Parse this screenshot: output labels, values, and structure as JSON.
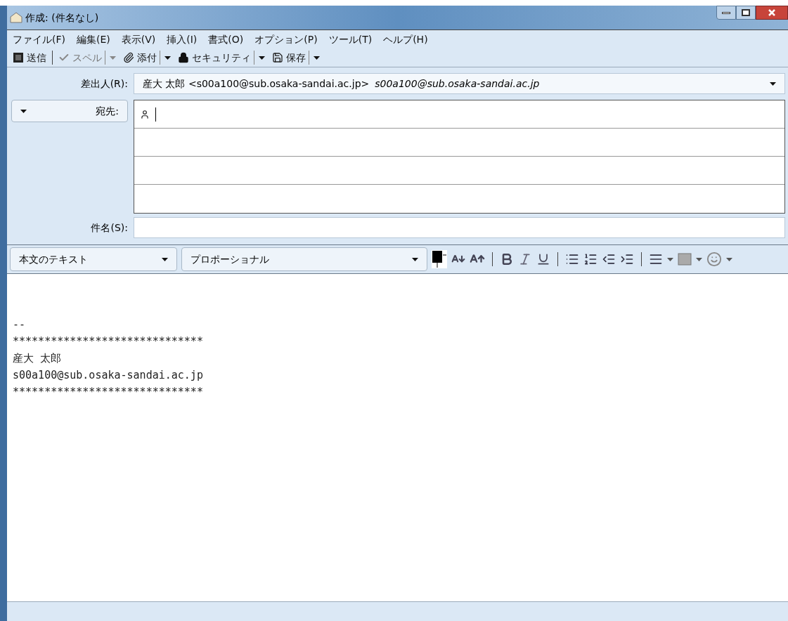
{
  "window": {
    "title": "作成: (件名なし)"
  },
  "menu": [
    "ファイル(F)",
    "編集(E)",
    "表示(V)",
    "挿入(I)",
    "書式(O)",
    "オプション(P)",
    "ツール(T)",
    "ヘルプ(H)"
  ],
  "toolbar": [
    {
      "label": "送信",
      "dropdown": false,
      "disabled": false
    },
    {
      "label": "スペル",
      "dropdown": true,
      "disabled": true
    },
    {
      "label": "添付",
      "dropdown": true,
      "disabled": false
    },
    {
      "label": "セキュリティ",
      "dropdown": true,
      "disabled": false
    },
    {
      "label": "保存",
      "dropdown": true,
      "disabled": false
    }
  ],
  "from": {
    "label": "差出人(R):",
    "name": "産大 太郎 <s00a100@sub.osaka-sandai.ac.jp>",
    "address": "s00a100@sub.osaka-sandai.ac.jp"
  },
  "recipients": {
    "type": "宛先:"
  },
  "subject": {
    "label": "件名(S):"
  },
  "format": {
    "paragraph": "本文のテキスト",
    "font": "プロポーショナル"
  },
  "body": [
    "--",
    "******************************",
    "産大 太郎",
    "s00a100@sub.osaka-sandai.ac.jp",
    "******************************"
  ]
}
